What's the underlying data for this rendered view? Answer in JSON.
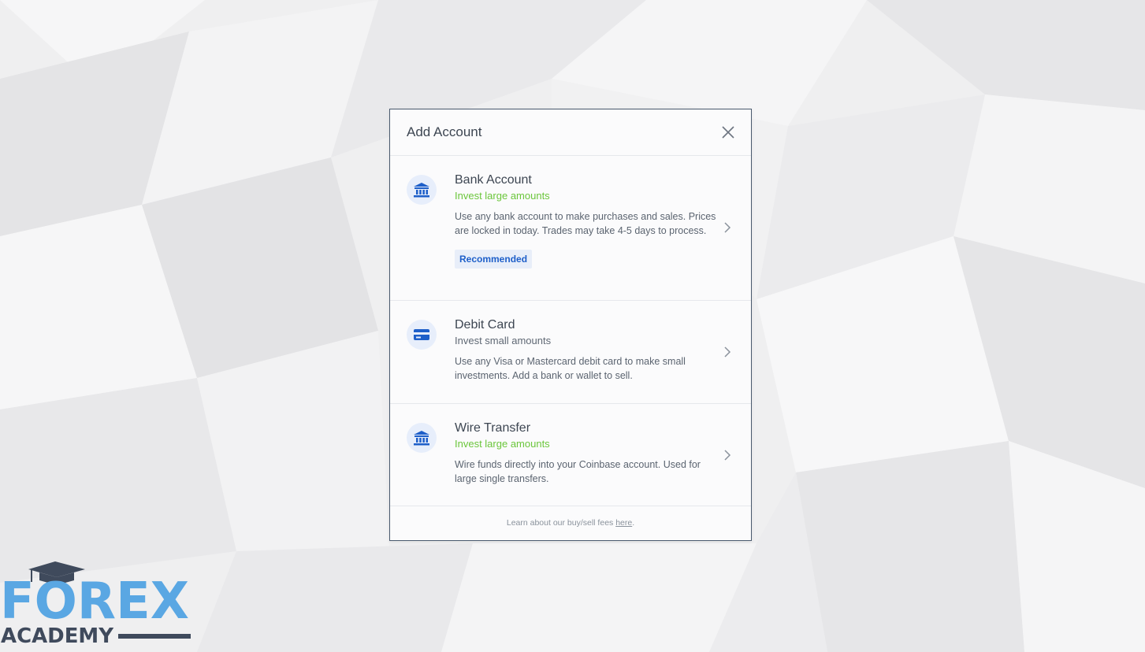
{
  "modal": {
    "title": "Add Account",
    "close_icon": "close-icon",
    "options": [
      {
        "icon": "bank-icon",
        "name": "Bank Account",
        "subtitle": "Invest large amounts",
        "subtitle_color": "#6bc63b",
        "description": "Use any bank account to make purchases and sales. Prices are locked in today. Trades may take 4-5 days to process.",
        "badge": "Recommended"
      },
      {
        "icon": "credit-card-icon",
        "name": "Debit Card",
        "subtitle": "Invest small amounts",
        "description": "Use any Visa or Mastercard debit card to make small investments. Add a bank or wallet to sell."
      },
      {
        "icon": "bank-icon",
        "name": "Wire Transfer",
        "subtitle": "Invest large amounts",
        "subtitle_color": "#6bc63b",
        "description": "Wire funds directly into your Coinbase account. Used for large single transfers."
      }
    ],
    "footer": {
      "text": "Learn about our buy/sell fees ",
      "link": "here",
      "suffix": "."
    }
  },
  "watermark": {
    "line1": "FOREX",
    "line2": "ACADEMY",
    "accent_color": "#5aa7e3",
    "dark_color": "#3f4a5c"
  },
  "colors": {
    "accent": "#1e5fc9",
    "green": "#6bc63b"
  }
}
